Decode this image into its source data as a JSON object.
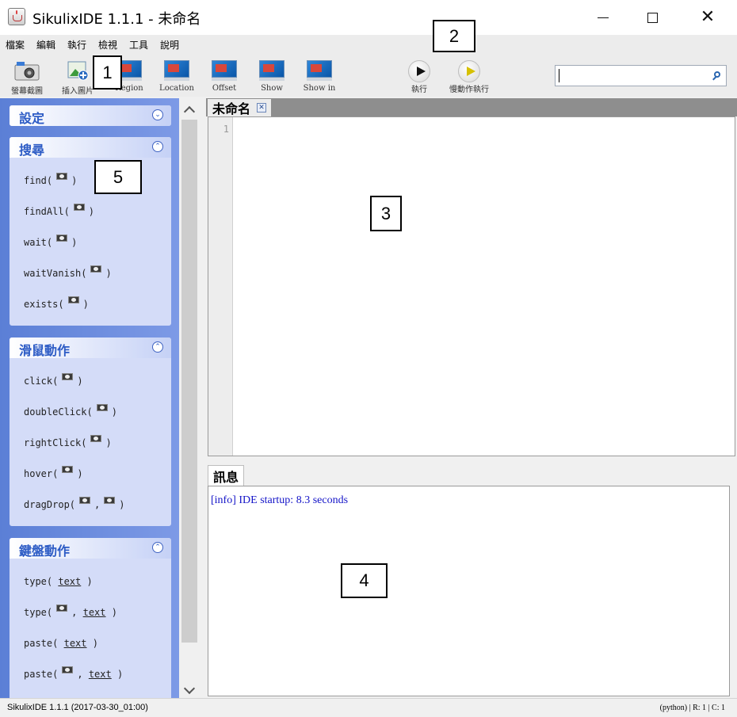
{
  "window": {
    "title": "SikulixIDE 1.1.1 - 未命名"
  },
  "menu": {
    "items": [
      "檔案",
      "編輯",
      "執行",
      "檢視",
      "工具",
      "說明"
    ]
  },
  "toolbar": {
    "buttons": [
      {
        "label": "螢幕截圖",
        "icon": "camera-icon"
      },
      {
        "label": "插入圖片",
        "icon": "insert-image-icon"
      },
      {
        "label": "Region",
        "icon": "monitor-icon"
      },
      {
        "label": "Location",
        "icon": "monitor-icon"
      },
      {
        "label": "Offset",
        "icon": "monitor-icon"
      },
      {
        "label": "Show",
        "icon": "monitor-icon"
      },
      {
        "label": "Show in",
        "icon": "monitor-icon"
      }
    ],
    "run_label": "執行",
    "slow_run_label": "慢動作執行",
    "search_value": ""
  },
  "sidebar": {
    "settings_title": "設定",
    "search_title": "搜尋",
    "search_items": [
      "find(",
      "findAll(",
      "wait(",
      "waitVanish(",
      "exists("
    ],
    "mouse_title": "滑鼠動作",
    "mouse_items": [
      "click(",
      "doubleClick(",
      "rightClick(",
      "hover(",
      "dragDrop("
    ],
    "keyboard_title": "鍵盤動作",
    "keyboard_items": [
      "type(",
      "type(",
      "paste(",
      "paste("
    ],
    "close_paren": ")",
    "comma": ",",
    "text_arg": "text"
  },
  "editor": {
    "tab_label": "未命名",
    "line_number": "1"
  },
  "messages": {
    "tab_label": "訊息",
    "line": "[info] IDE startup: 8.3 seconds"
  },
  "status": {
    "left": "SikulixIDE 1.1.1 (2017-03-30_01:00)",
    "right": "(python) | R: 1 | C: 1"
  },
  "annotations": [
    "1",
    "2",
    "3",
    "4",
    "5"
  ]
}
